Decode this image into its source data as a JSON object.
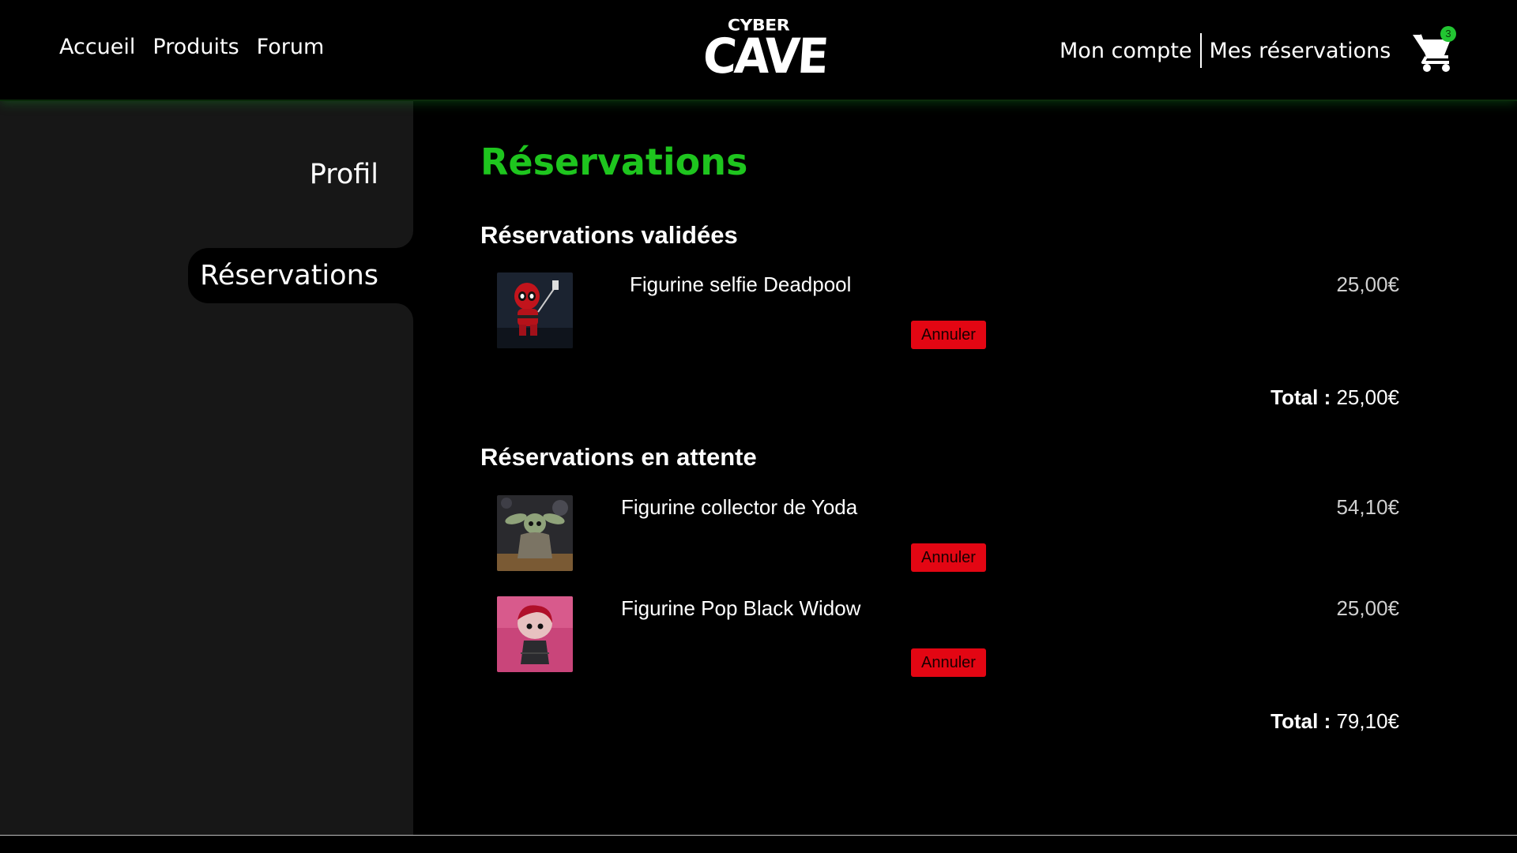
{
  "header": {
    "nav_left": [
      "Accueil",
      "Produits",
      "Forum"
    ],
    "logo_top": "CYBER",
    "logo_bottom": "CAVE",
    "nav_right": [
      "Mon compte",
      "Mes réservations"
    ],
    "cart_count": "3"
  },
  "sidebar": {
    "items": [
      {
        "label": "Profil",
        "active": false
      },
      {
        "label": "Réservations",
        "active": true
      }
    ]
  },
  "main": {
    "title": "Réservations",
    "validated": {
      "heading": "Réservations validées",
      "items": [
        {
          "name": "Figurine selfie Deadpool",
          "price": "25,00€",
          "cancel_label": "Annuler",
          "image": "deadpool-figurine"
        }
      ],
      "total_label": "Total :",
      "total_value": "25,00€"
    },
    "pending": {
      "heading": "Réservations en attente",
      "items": [
        {
          "name": "Figurine collector de Yoda",
          "price": "54,10€",
          "cancel_label": "Annuler",
          "image": "yoda-figurine"
        },
        {
          "name": "Figurine Pop Black Widow",
          "price": "25,00€",
          "cancel_label": "Annuler",
          "image": "black-widow-figurine"
        }
      ],
      "total_label": "Total :",
      "total_value": "79,10€"
    }
  },
  "colors": {
    "accent_green": "#1ec51e",
    "cancel_red": "#e30613",
    "sidebar_bg": "#171717",
    "page_bg": "#000000"
  }
}
